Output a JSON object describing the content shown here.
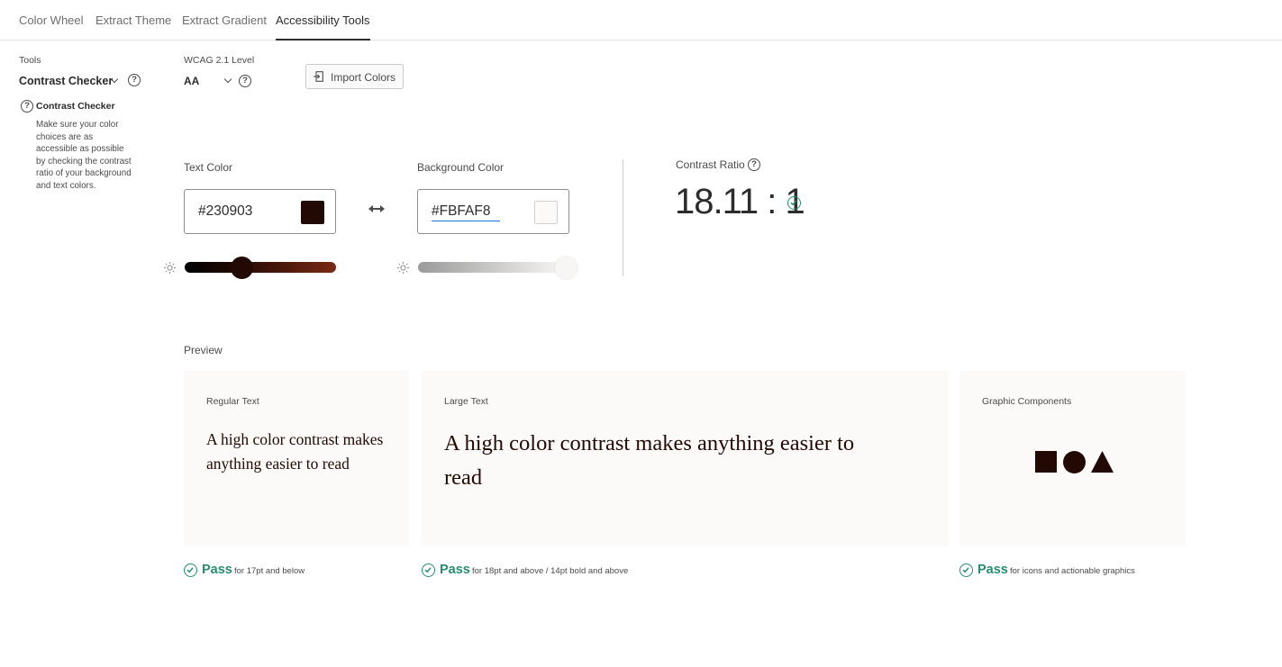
{
  "tabs": [
    {
      "label": "Color Wheel",
      "active": false
    },
    {
      "label": "Extract Theme",
      "active": false
    },
    {
      "label": "Extract Gradient",
      "active": false
    },
    {
      "label": "Accessibility Tools",
      "active": true
    }
  ],
  "tools": {
    "label": "Tools",
    "selected": "Contrast Checker",
    "help": "?",
    "description_title": "Contrast Checker",
    "description": "Make sure your color choices are as accessible as possible by checking the contrast ratio of your background and text colors."
  },
  "wcag": {
    "label": "WCAG 2.1 Level",
    "selected": "AA",
    "help": "?"
  },
  "import_button": {
    "label": "Import Colors"
  },
  "text_color": {
    "label": "Text Color",
    "hex": "#230903",
    "swatch": "#230903",
    "brightness_level": 0.38
  },
  "background_color": {
    "label": "Background Color",
    "hex": "#FBFAF8",
    "swatch": "#FBFAF8",
    "brightness_level": 0.98
  },
  "contrast": {
    "label": "Contrast Ratio",
    "value": "18.11 : 1",
    "help": "?"
  },
  "preview": {
    "title": "Preview",
    "regular": {
      "label": "Regular Text",
      "text": "A high color contrast makes anything easier to read",
      "status": "Pass",
      "note": "for 17pt and below"
    },
    "large": {
      "label": "Large Text",
      "text": "A high color contrast makes anything easier to read",
      "status": "Pass",
      "note": "for 18pt and above / 14pt bold and above"
    },
    "graphic": {
      "label": "Graphic Components",
      "status": "Pass",
      "note": "for icons and actionable graphics"
    }
  },
  "colors": {
    "pass_green": "#268e6c",
    "accent_blue": "#1473e6"
  }
}
